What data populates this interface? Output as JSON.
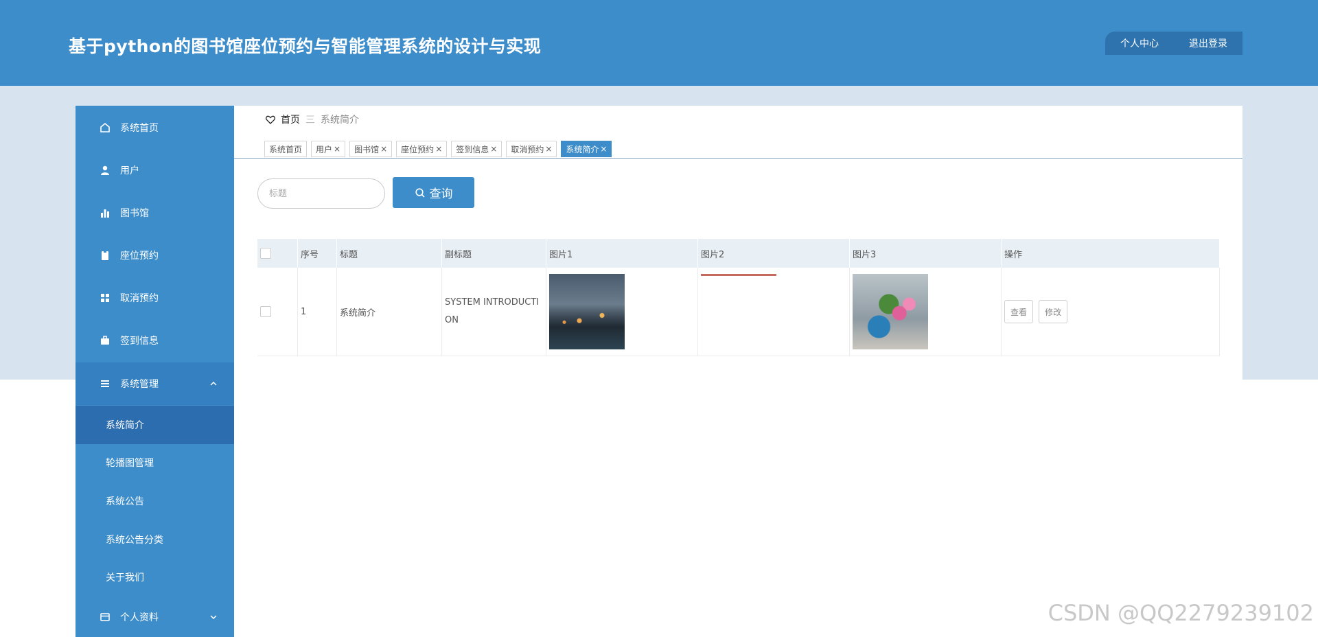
{
  "header": {
    "title": "基于python的图书馆座位预约与智能管理系统的设计与实现",
    "personal_center": "个人中心",
    "logout": "退出登录"
  },
  "sidebar": {
    "items": [
      {
        "label": "系统首页",
        "icon": "home-icon"
      },
      {
        "label": "用户",
        "icon": "user-icon"
      },
      {
        "label": "图书馆",
        "icon": "bar-chart-icon"
      },
      {
        "label": "座位预约",
        "icon": "clipboard-icon"
      },
      {
        "label": "取消预约",
        "icon": "grid-icon"
      },
      {
        "label": "签到信息",
        "icon": "briefcase-icon"
      }
    ],
    "system_group": {
      "label": "系统管理",
      "icon": "menu-icon"
    },
    "sub_items": [
      {
        "label": "系统简介"
      },
      {
        "label": "轮播图管理"
      },
      {
        "label": "系统公告"
      },
      {
        "label": "系统公告分类"
      },
      {
        "label": "关于我们"
      }
    ],
    "profile_group": {
      "label": "个人资料",
      "icon": "card-icon"
    }
  },
  "breadcrumb": {
    "home": "首页",
    "separator": "三",
    "current": "系统简介"
  },
  "tabs": [
    {
      "label": "系统首页",
      "closable": false
    },
    {
      "label": "用户",
      "closable": true
    },
    {
      "label": "图书馆",
      "closable": true
    },
    {
      "label": "座位预约",
      "closable": true
    },
    {
      "label": "签到信息",
      "closable": true
    },
    {
      "label": "取消预约",
      "closable": true
    },
    {
      "label": "系统简介",
      "closable": true,
      "active": true
    }
  ],
  "tab_close": "×",
  "search": {
    "placeholder": "标题",
    "button": "查询"
  },
  "table": {
    "headers": [
      "序号",
      "标题",
      "副标题",
      "图片1",
      "图片2",
      "图片3",
      "操作"
    ],
    "rows": [
      {
        "index": "1",
        "title": "系统简介",
        "subtitle": "SYSTEM INTRODUCTION",
        "images": [
          "night-lake-image",
          "blank-image",
          "flower-image"
        ]
      }
    ],
    "actions": {
      "view": "查看",
      "edit": "修改"
    }
  },
  "watermark": "CSDN @QQ2279239102",
  "colors": {
    "primary": "#3e8dcb",
    "active_sub": "#2c6db0",
    "band": "#d7e3ee"
  }
}
